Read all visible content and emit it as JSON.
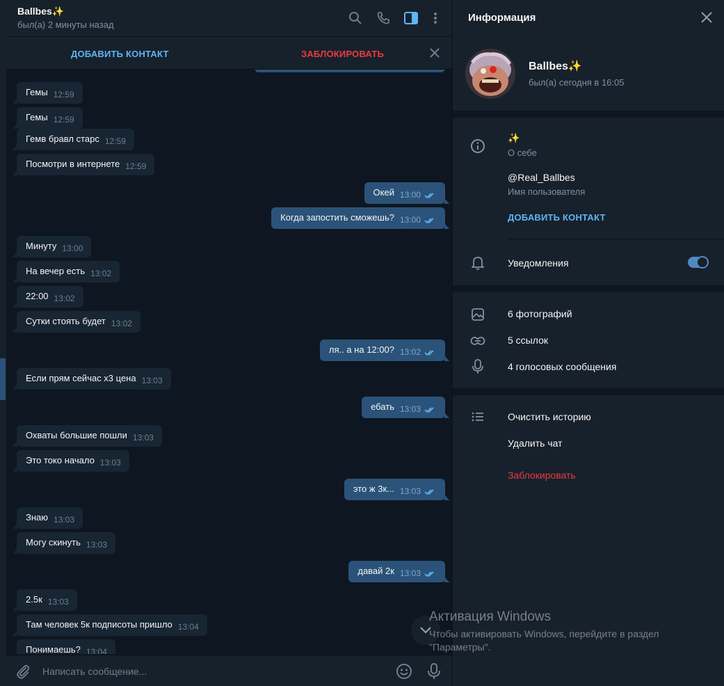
{
  "chat": {
    "name": "Ballbes✨",
    "status": "был(а) 2 минуты назад",
    "add_contact": "ДОБАВИТЬ КОНТАКТ",
    "block": "ЗАБЛОКИРОВАТЬ",
    "composer_placeholder": "Написать сообщение...",
    "messages": [
      {
        "dir": "in",
        "text": "Гемы",
        "time": "12:59"
      },
      {
        "dir": "in",
        "text": "Гемы",
        "time": "12:59"
      },
      {
        "dir": "in",
        "text": "Гемв бравл старс",
        "time": "12:59"
      },
      {
        "dir": "in",
        "text": "Посмотри в интернете",
        "time": "12:59"
      },
      {
        "dir": "out",
        "text": "Окей",
        "time": "13:00"
      },
      {
        "dir": "out",
        "text": "Когда запостить сможешь?",
        "time": "13:00"
      },
      {
        "dir": "in",
        "text": "Минуту",
        "time": "13:00"
      },
      {
        "dir": "in",
        "text": "На вечер есть",
        "time": "13:02"
      },
      {
        "dir": "in",
        "text": "22:00",
        "time": "13:02"
      },
      {
        "dir": "in",
        "text": "Сутки стоять будет",
        "time": "13:02"
      },
      {
        "dir": "out",
        "text": "ля.. а на 12:00?",
        "time": "13:02"
      },
      {
        "dir": "in",
        "text": "Если прям сейчас x3 цена",
        "time": "13:03"
      },
      {
        "dir": "out",
        "text": "ебать",
        "time": "13:03"
      },
      {
        "dir": "in",
        "text": "Охваты большие пошли",
        "time": "13:03"
      },
      {
        "dir": "in",
        "text": "Это токо начало",
        "time": "13:03"
      },
      {
        "dir": "out",
        "text": "это ж 3к...",
        "time": "13:03"
      },
      {
        "dir": "in",
        "text": "Знаю",
        "time": "13:03"
      },
      {
        "dir": "in",
        "text": "Могу скинуть",
        "time": "13:03"
      },
      {
        "dir": "out",
        "text": "давай 2к",
        "time": "13:03"
      },
      {
        "dir": "in",
        "text": "2.5к",
        "time": "13:03"
      },
      {
        "dir": "in",
        "text": "Там человек 5к подписоты пришло",
        "time": "13:04"
      },
      {
        "dir": "in",
        "text": "Понимаешь?",
        "time": "13:04"
      }
    ]
  },
  "panel": {
    "title": "Информация",
    "name": "Ballbes✨",
    "status": "был(а) сегодня в 16:05",
    "bio": "✨",
    "bio_label": "О себе",
    "username": "@Real_Ballbes",
    "username_label": "Имя пользователя",
    "add_contact": "ДОБАВИТЬ КОНТАКТ",
    "notifications": "Уведомления",
    "notifications_on": true,
    "photos": "6 фотографий",
    "links": "5 ссылок",
    "voice": "4 голосовых сообщения",
    "clear_history": "Очистить историю",
    "delete_chat": "Удалить чат",
    "block": "Заблокировать"
  },
  "watermark": {
    "title": "Активация Windows",
    "line1": "Чтобы активировать Windows, перейдите в раздел",
    "line2": "\"Параметры\"."
  },
  "colors": {
    "accent": "#5eb5f7",
    "danger": "#ec3942",
    "bubble_in": "#182533",
    "bubble_out": "#2b5278"
  }
}
